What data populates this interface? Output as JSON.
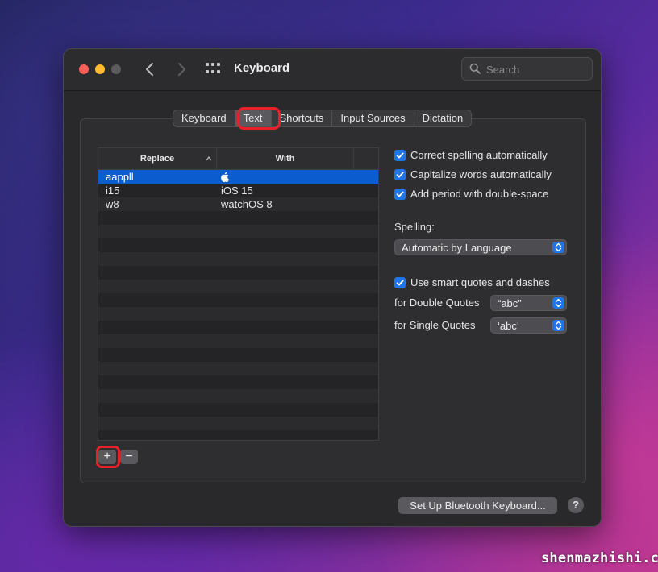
{
  "window": {
    "title": "Keyboard"
  },
  "search": {
    "placeholder": "Search",
    "value": ""
  },
  "tabs": [
    {
      "label": "Keyboard",
      "selected": false
    },
    {
      "label": "Text",
      "selected": true
    },
    {
      "label": "Shortcuts",
      "selected": false
    },
    {
      "label": "Input Sources",
      "selected": false
    },
    {
      "label": "Dictation",
      "selected": false
    }
  ],
  "table": {
    "columns": {
      "replace": "Replace",
      "with": "With"
    },
    "rows": [
      {
        "replace": "aappll",
        "with": "",
        "selected": true
      },
      {
        "replace": "i15",
        "with": "iOS 15",
        "selected": false
      },
      {
        "replace": "w8",
        "with": "watchOS 8",
        "selected": false
      }
    ]
  },
  "options": {
    "correct_spelling": {
      "label": "Correct spelling automatically",
      "checked": true
    },
    "capitalize_words": {
      "label": "Capitalize words automatically",
      "checked": true
    },
    "add_period": {
      "label": "Add period with double-space",
      "checked": true
    },
    "spelling_label": "Spelling:",
    "spelling_value": "Automatic by Language",
    "smart_quotes": {
      "label": "Use smart quotes and dashes",
      "checked": true
    },
    "double_quotes_label": "for Double Quotes",
    "double_quotes_value": "“abc”",
    "single_quotes_label": "for Single Quotes",
    "single_quotes_value": "‘abc’"
  },
  "buttons": {
    "add": "+",
    "remove": "−",
    "bluetooth": "Set Up Bluetooth Keyboard...",
    "help": "?"
  },
  "watermark": "shenmazhishi.com",
  "colors": {
    "accent": "#1f75e8",
    "highlight": "#e8202a",
    "selection": "#0b5ccf"
  }
}
